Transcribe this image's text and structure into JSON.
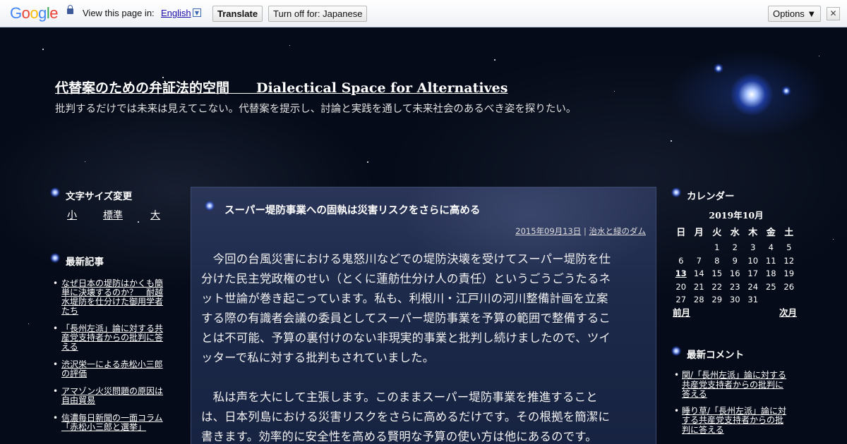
{
  "translate_bar": {
    "logo_letters": [
      {
        "ch": "G",
        "color": "#4285f4"
      },
      {
        "ch": "o",
        "color": "#ea4335"
      },
      {
        "ch": "o",
        "color": "#fbbc05"
      },
      {
        "ch": "g",
        "color": "#4285f4"
      },
      {
        "ch": "l",
        "color": "#34a853"
      },
      {
        "ch": "e",
        "color": "#ea4335"
      }
    ],
    "prompt": "View this page in:",
    "language": "English",
    "translate_label": "Translate",
    "turn_off_label": "Turn off for: Japanese",
    "options_label": "Options ▼",
    "close_label": "✕"
  },
  "header": {
    "title": "代替案のための弁証法的空間　　Dialectical Space for Alternatives",
    "description": "批判するだけでは未来は見えてこない。代替案を提示し、討論と実践を通して未来社会のあるべき姿を探りたい。"
  },
  "left_sidebar": {
    "font_size_heading": "文字サイズ変更",
    "font_sizes": [
      "小",
      "標準",
      "大"
    ],
    "recent_heading": "最新記事",
    "recent_posts": [
      [
        "なぜ日本の堤防はかくも簡",
        "単に決壊するのか？　耐越",
        "水堤防を仕分けた御用学者",
        "たち"
      ],
      [
        "「長州左派」論に対する共",
        "産党支持者からの批判に答",
        "える"
      ],
      [
        "渋沢栄一による赤松小三郎",
        "の評価"
      ],
      [
        "アマゾン火災問題の原因は",
        "自由貿易"
      ],
      [
        "信濃毎日新聞の一面コラム",
        "「赤松小三郎と選挙」"
      ]
    ]
  },
  "post": {
    "title": "スーパー堤防事業への固執は災害リスクをさらに高める",
    "date": "2015年09月13日",
    "separator": " | ",
    "category": "治水と緑のダム",
    "paragraph1": [
      "　今回の台風災害における鬼怒川などでの堤防決壊を受けてスーパー堤防を仕",
      "分けた民主党政権のせい（とくに蓮舫仕分け人の責任）というごうごうたるネ",
      "ット世論が巻き起こっています。私も、利根川・江戸川の河川整備計画を立案",
      "する際の有識者会議の委員としてスーパー堤防事業を予算の範囲で整備するこ",
      "とは不可能、予算の裏付けのない非現実的事業と批判し続けましたので、ツイ",
      "ッターで私に対する批判もされていました。"
    ],
    "paragraph2": [
      "　私は声を大にして主張します。このままスーパー堤防事業を推進すること",
      "は、日本列島における災害リスクをさらに高めるだけです。その根拠を簡潔に",
      "書きます。効率的に安全性を高める賢明な予算の使い方は他にあるのです。"
    ]
  },
  "calendar": {
    "heading": "カレンダー",
    "caption": "2019年10月",
    "weekdays": [
      "日",
      "月",
      "火",
      "水",
      "木",
      "金",
      "土"
    ],
    "weeks": [
      [
        "",
        "",
        "1",
        "2",
        "3",
        "4",
        "5"
      ],
      [
        "6",
        "7",
        "8",
        "9",
        "10",
        "11",
        "12"
      ],
      [
        "13",
        "14",
        "15",
        "16",
        "17",
        "18",
        "19"
      ],
      [
        "20",
        "21",
        "22",
        "23",
        "24",
        "25",
        "26"
      ],
      [
        "27",
        "28",
        "29",
        "30",
        "31",
        "",
        ""
      ]
    ],
    "today": "13",
    "prev_label": "前月",
    "next_label": "次月"
  },
  "comments": {
    "heading": "最新コメント",
    "items": [
      {
        "author": "関",
        "sep": "/",
        "title": "「長州左派」論に対する共産党支持者からの批判に答える",
        "lines": [
          "関/「長州左派」論に対する",
          "共産党支持者からの批判に",
          "答える"
        ]
      },
      {
        "author": "睡り草",
        "sep": "/",
        "title": "「長州左派」論に対する共産党支持者からの批判に答える",
        "lines": [
          "睡り草/「長州左派」論に対",
          "する共産党支持者からの批",
          "判に答える"
        ]
      }
    ]
  },
  "colors": {
    "background": "#050b18",
    "post_panel": "#1d2a4a",
    "text": "#ffffff"
  }
}
